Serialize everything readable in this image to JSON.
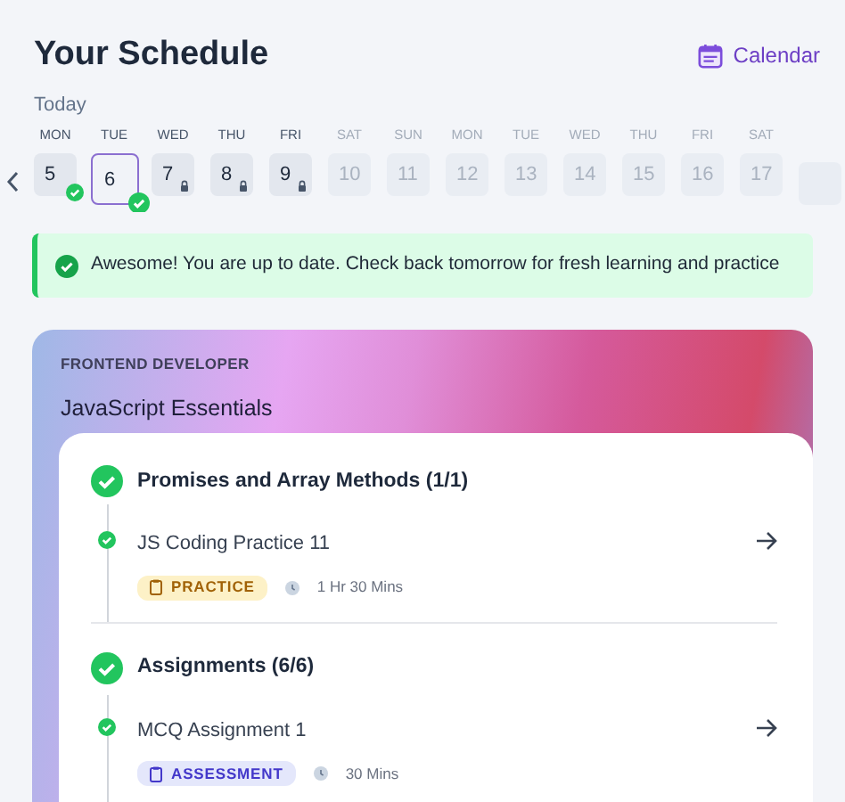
{
  "header": {
    "title": "Your Schedule",
    "calendar_link": "Calendar",
    "subtitle": "Today"
  },
  "days": [
    {
      "weekday": "MON",
      "date": "5",
      "completed": true,
      "locked": false,
      "selected": false,
      "upcoming": false
    },
    {
      "weekday": "TUE",
      "date": "6",
      "completed": true,
      "locked": false,
      "selected": true,
      "upcoming": false
    },
    {
      "weekday": "WED",
      "date": "7",
      "completed": false,
      "locked": true,
      "selected": false,
      "upcoming": false
    },
    {
      "weekday": "THU",
      "date": "8",
      "completed": false,
      "locked": true,
      "selected": false,
      "upcoming": false
    },
    {
      "weekday": "FRI",
      "date": "9",
      "completed": false,
      "locked": true,
      "selected": false,
      "upcoming": false
    },
    {
      "weekday": "SAT",
      "date": "10",
      "completed": false,
      "locked": false,
      "selected": false,
      "upcoming": true
    },
    {
      "weekday": "SUN",
      "date": "11",
      "completed": false,
      "locked": false,
      "selected": false,
      "upcoming": true
    },
    {
      "weekday": "MON",
      "date": "12",
      "completed": false,
      "locked": false,
      "selected": false,
      "upcoming": true
    },
    {
      "weekday": "TUE",
      "date": "13",
      "completed": false,
      "locked": false,
      "selected": false,
      "upcoming": true
    },
    {
      "weekday": "WED",
      "date": "14",
      "completed": false,
      "locked": false,
      "selected": false,
      "upcoming": true
    },
    {
      "weekday": "THU",
      "date": "15",
      "completed": false,
      "locked": false,
      "selected": false,
      "upcoming": true
    },
    {
      "weekday": "FRI",
      "date": "16",
      "completed": false,
      "locked": false,
      "selected": false,
      "upcoming": true
    },
    {
      "weekday": "SAT",
      "date": "17",
      "completed": false,
      "locked": false,
      "selected": false,
      "upcoming": true
    }
  ],
  "banner": {
    "message": "Awesome! You are up to date. Check back tomorrow for fresh learning and practice"
  },
  "course": {
    "track": "FRONTEND DEVELOPER",
    "title": "JavaScript Essentials",
    "groups": [
      {
        "title": "Promises and Array Methods (1/1)",
        "completed": true,
        "items": [
          {
            "title": "JS Coding Practice 11",
            "completed": true,
            "kind": "practice",
            "tag": "PRACTICE",
            "duration": "1 Hr 30 Mins"
          }
        ]
      },
      {
        "title": "Assignments (6/6)",
        "completed": true,
        "items": [
          {
            "title": "MCQ Assignment 1",
            "completed": true,
            "kind": "assessment",
            "tag": "ASSESSMENT",
            "duration": "30 Mins"
          }
        ]
      }
    ]
  }
}
